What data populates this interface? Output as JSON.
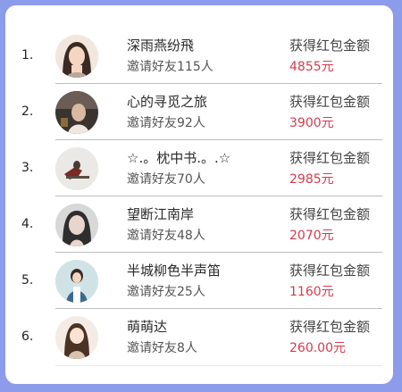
{
  "leaderboard": {
    "rows": [
      {
        "rank": "1.",
        "name": "深雨燕纷飛",
        "invite": "邀请好友115人",
        "amount_label": "获得红包金额",
        "amount": "4855元"
      },
      {
        "rank": "2.",
        "name": "心的寻觅之旅",
        "invite": "邀请好友92人",
        "amount_label": "获得红包金额",
        "amount": "3900元"
      },
      {
        "rank": "3.",
        "name": "☆.。枕中书.。.☆",
        "invite": "邀请好友70人",
        "amount_label": "获得红包金额",
        "amount": "2985元"
      },
      {
        "rank": "4.",
        "name": "望断江南岸",
        "invite": "邀请好友48人",
        "amount_label": "获得红包金额",
        "amount": "2070元"
      },
      {
        "rank": "5.",
        "name": "半城柳色半声笛",
        "invite": "邀请好友25人",
        "amount_label": "获得红包金额",
        "amount": "1160元"
      },
      {
        "rank": "6.",
        "name": "萌萌达",
        "invite": "邀请好友8人",
        "amount_label": "获得红包金额",
        "amount": "260.00元"
      }
    ]
  },
  "colors": {
    "background": "#8c9bea",
    "amount": "#d83a4e"
  }
}
